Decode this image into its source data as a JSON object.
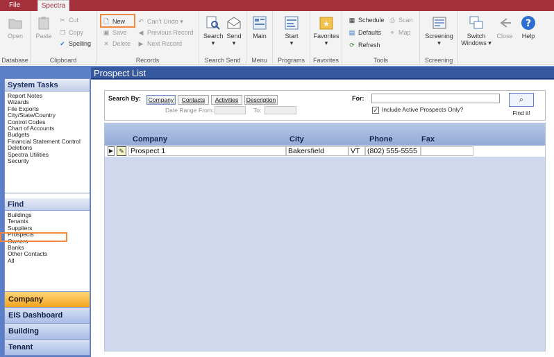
{
  "tabs": {
    "file": "File",
    "spectra": "Spectra"
  },
  "ribbon": {
    "database": {
      "open": "Open",
      "label": "Database"
    },
    "clipboard": {
      "paste": "Paste",
      "cut": "Cut",
      "copy": "Copy",
      "spelling": "Spelling",
      "label": "Clipboard"
    },
    "records": {
      "new": "New",
      "save": "Save",
      "delete": "Delete",
      "cant_undo": "Can't Undo",
      "previous": "Previous Record",
      "next": "Next Record",
      "label": "Records"
    },
    "searchsend": {
      "search": "Search",
      "send": "Send",
      "label": "Search Send"
    },
    "menu": {
      "main": "Main",
      "label": "Menu"
    },
    "programs": {
      "start": "Start",
      "label": "Programs"
    },
    "favorites": {
      "favorites": "Favorites",
      "label": "Favorites"
    },
    "tools": {
      "schedule": "Schedule",
      "scan": "Scan",
      "defaults": "Defaults",
      "map": "Map",
      "refresh": "Refresh",
      "label": "Tools"
    },
    "screening": {
      "screening": "Screening",
      "label": "Screening"
    },
    "window": {
      "switch": "Switch Windows",
      "close": "Close",
      "help": "Help"
    }
  },
  "left": {
    "tasks_title": "System Tasks",
    "tasks": [
      "Report Notes",
      "Wizards",
      "File Exports",
      "City/State/Country",
      "Control Codes",
      "Chart of Accounts",
      "Budgets",
      "Financial Statement Control",
      "Deletions",
      "Spectra Utilities",
      "Security"
    ],
    "find_title": "Find",
    "find": [
      "Buildings",
      "Tenants",
      "Suppliers",
      "Prospects",
      "Owners",
      "Banks",
      "Other Contacts",
      "All"
    ],
    "nav": [
      "Company",
      "EIS Dashboard",
      "Building",
      "Tenant"
    ]
  },
  "main": {
    "title": "Prospect List",
    "search_by": "Search By:",
    "search_tabs": [
      "Company",
      "Contacts",
      "Activities",
      "Description"
    ],
    "date_range": "Date Range",
    "from": "From:",
    "to": "To:",
    "for": "For:",
    "include_active": "Include Active Prospects Only?",
    "find_it": "Find it!",
    "columns": [
      "Company",
      "City",
      "Phone",
      "Fax"
    ],
    "rows": [
      {
        "company": "Prospect 1",
        "city": "Bakersfield",
        "state": "VT",
        "phone": "(802) 555-5555",
        "fax": ""
      }
    ]
  }
}
